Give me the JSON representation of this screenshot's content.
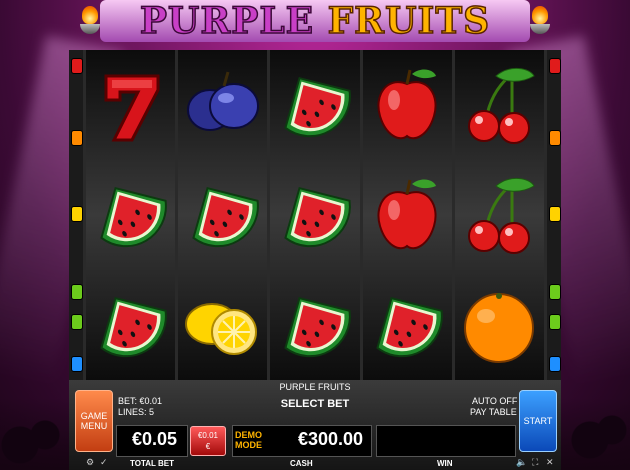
{
  "header": {
    "logo_left": "PURPLE",
    "logo_right": "FRUITS"
  },
  "reels": [
    [
      "seven-symbol",
      "watermelon-symbol",
      "watermelon-symbol"
    ],
    [
      "plum-symbol",
      "watermelon-symbol",
      "lemon-symbol"
    ],
    [
      "watermelon-symbol",
      "watermelon-symbol",
      "watermelon-symbol"
    ],
    [
      "apple-symbol",
      "apple-symbol",
      "watermelon-symbol"
    ],
    [
      "cherries-symbol",
      "cherries-symbol",
      "orange-symbol"
    ]
  ],
  "indicator_colors": [
    "#e01b1b",
    "#ff8a00",
    "#ffd200",
    "#6ccc1c",
    "#6ccc1c",
    "#1e8fff"
  ],
  "panel": {
    "game_title": "PURPLE FRUITS",
    "bet_info": "BET: €0.01",
    "lines_info": "LINES: 5",
    "select_bet": "SELECT BET",
    "auto_label": "AUTO OFF",
    "pay_table": "PAY TABLE",
    "menu_button_line1": "GAME",
    "menu_button_line2": "MENU",
    "start_button": "START",
    "total_bet_value": "€0.05",
    "total_bet_label": "TOTAL BET",
    "coin_value_line1": "€0.01",
    "coin_value_line2": "€",
    "demo_line1": "DEMO",
    "demo_line2": "MODE",
    "cash_value": "€300.00",
    "cash_label": "CASH",
    "win_label": "WIN"
  }
}
